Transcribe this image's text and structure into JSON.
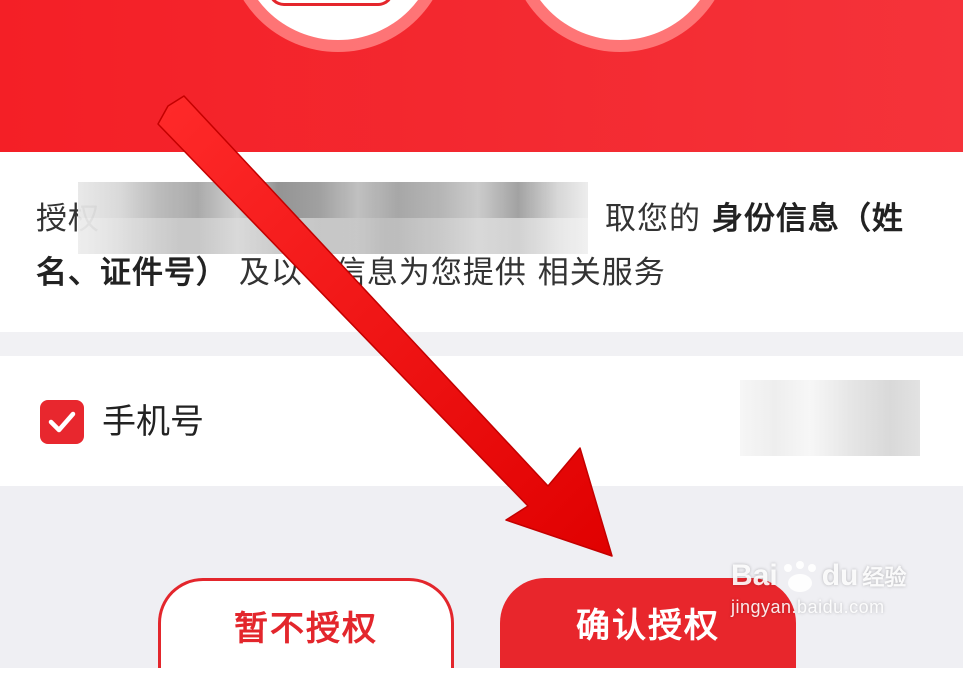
{
  "auth": {
    "prefix": "授权",
    "suffix_plain": "取您的",
    "suffix_bold": "身份信息（姓名、证件号）",
    "rest": "及以下信息为您提供 相关服务"
  },
  "phone": {
    "label": "手机号",
    "checked": true
  },
  "buttons": {
    "deny": "暂不授权",
    "confirm": "确认授权"
  },
  "colors": {
    "brand_red": "#e8262c",
    "background_gray": "#efeff3"
  },
  "watermark": {
    "main": "Bai",
    "main2": "du",
    "cn": "经验",
    "url": "jingyan.baidu.com"
  },
  "icons": {
    "checkbox": "check-icon",
    "overlay": "red-arrow-icon"
  }
}
